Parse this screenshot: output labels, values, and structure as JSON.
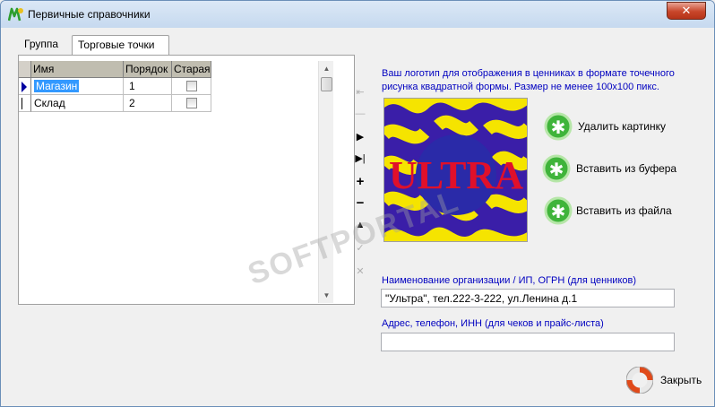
{
  "window": {
    "title": "Первичные справочники",
    "close_label": "✕"
  },
  "tabs": [
    {
      "label": "Группа",
      "active": false
    },
    {
      "label": "Торговые точки",
      "active": true
    }
  ],
  "grid": {
    "columns": [
      "Имя",
      "Порядок",
      "Старая"
    ],
    "rows": [
      {
        "name": "Магазин",
        "order": "1",
        "old": false,
        "selected": true
      },
      {
        "name": "Склад",
        "order": "2",
        "old": false,
        "selected": false
      }
    ]
  },
  "navigator": [
    "first-icon",
    "prior-icon",
    "next-icon",
    "last-icon",
    "insert-icon",
    "delete-icon",
    "edit-icon",
    "post-icon",
    "cancel-icon"
  ],
  "logo": {
    "caption": "Ваш логотип для отображения в ценниках в формате  точечного рисунка квадратной формы. Размер не менее 100x100 пикс.",
    "image_text": "ULTRA"
  },
  "actions": {
    "delete_image": "Удалить картинку",
    "paste_buffer": "Вставить из буфера",
    "paste_file": "Вставить из файла"
  },
  "org": {
    "name_label": "Наименование организации / ИП, ОГРН (для ценников)",
    "name_value": "\"Ультра\", тел.222-3-222, ул.Ленина д.1",
    "address_label": "Адрес, телефон, ИНН (для чеков и прайс-листа)",
    "address_value": ""
  },
  "footer": {
    "close_label": "Закрыть"
  },
  "watermark": "SOFTPORTAL",
  "colors": {
    "accent_blue": "#0000c0",
    "selection": "#3399ff",
    "logo_yellow": "#f5e400",
    "logo_purple": "#3a1ea8",
    "logo_red": "#e0102a",
    "action_green": "#3fb43a"
  }
}
